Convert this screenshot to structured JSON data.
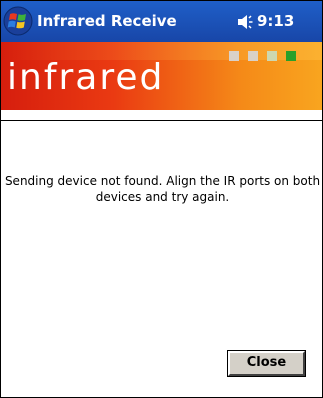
{
  "titlebar": {
    "title": "Infrared Receive",
    "time": "9:13",
    "start_icon": "windows-flag-icon",
    "volume_icon": "speaker-icon"
  },
  "banner": {
    "word": "infrared",
    "indicator_colors": [
      "#d9d1c8",
      "#d9d1c8",
      "#cdd8b0",
      "#2aa02a"
    ]
  },
  "message": {
    "text": "Sending device not found. Align the IR ports on both devices and try again."
  },
  "actions": {
    "close_label": "Close"
  },
  "colors": {
    "titlebar": "#1f5fc8",
    "banner_start": "#d61e0d",
    "banner_end": "#f9a51f"
  }
}
